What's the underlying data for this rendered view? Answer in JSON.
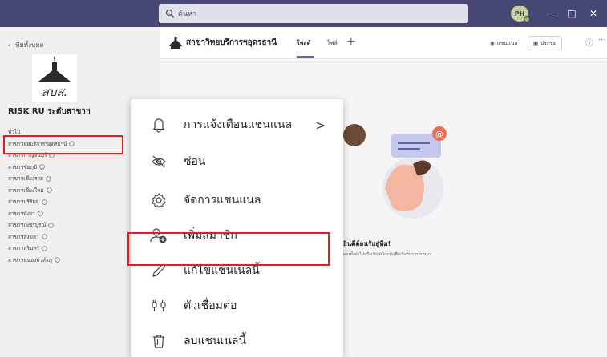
{
  "titlebar": {
    "search_placeholder": "ค้นหา",
    "avatar_initials": "PH",
    "minimize": "—",
    "maximize": "□",
    "close": "✕"
  },
  "sidebar": {
    "back_label": "ทีมทั้งหมด",
    "team_name": "RISK RU ระดับสาขาฯ",
    "more": "···",
    "channels": [
      "ทั่วไป",
      "สาขาวิทยบริการฯอุดรธานี",
      "สาขาฯกาญจนบุรี",
      "สาขาฯชัยภูมิ",
      "สาขาฯเชียงราย",
      "สาขาฯเชียงใหม่",
      "สาขาฯบุรีรัมย์",
      "สาขาฯพังงา",
      "สาขาฯเพชรบูรณ์",
      "สาขาฯสงขลา",
      "สาขาฯสุรินทร์",
      "สาขาฯหนองบัวลำภู"
    ]
  },
  "header": {
    "channel_title": "สาขาวิทยบริการฯอุดรธานี",
    "tabs": [
      "โพสต์",
      "ไฟล์"
    ],
    "add_tab": "+",
    "channel_btn": "แชนแนล",
    "meet_btn": "ประชุม",
    "info": "ⓘ",
    "more": "···"
  },
  "main": {
    "welcome_title": "ยินดีต้อนรับสู่ทีม!",
    "welcome_sub": "ลองตั้งค่าไปหรือเชิญพนักงานเพื่อเริ่มต้นการสนทนา"
  },
  "menu": {
    "items": [
      {
        "label": "การแจ้งเตือนแชนแนล",
        "icon": "bell-icon",
        "chevron": ">"
      },
      {
        "label": "ซ่อน",
        "icon": "eye-off-icon"
      },
      {
        "label": "จัดการแชนแนล",
        "icon": "gear-icon"
      },
      {
        "label": "เพิ่มสมาชิก",
        "icon": "add-person-icon"
      },
      {
        "label": "แก้ไขแชนเนลนี้",
        "icon": "pencil-icon"
      },
      {
        "label": "ตัวเชื่อมต่อ",
        "icon": "connector-icon"
      },
      {
        "label": "ลบแชนเนลนี้",
        "icon": "trash-icon"
      }
    ]
  },
  "colors": {
    "titlebar": "#464775",
    "accent": "#6264a7",
    "highlight_box": "#e02020"
  }
}
